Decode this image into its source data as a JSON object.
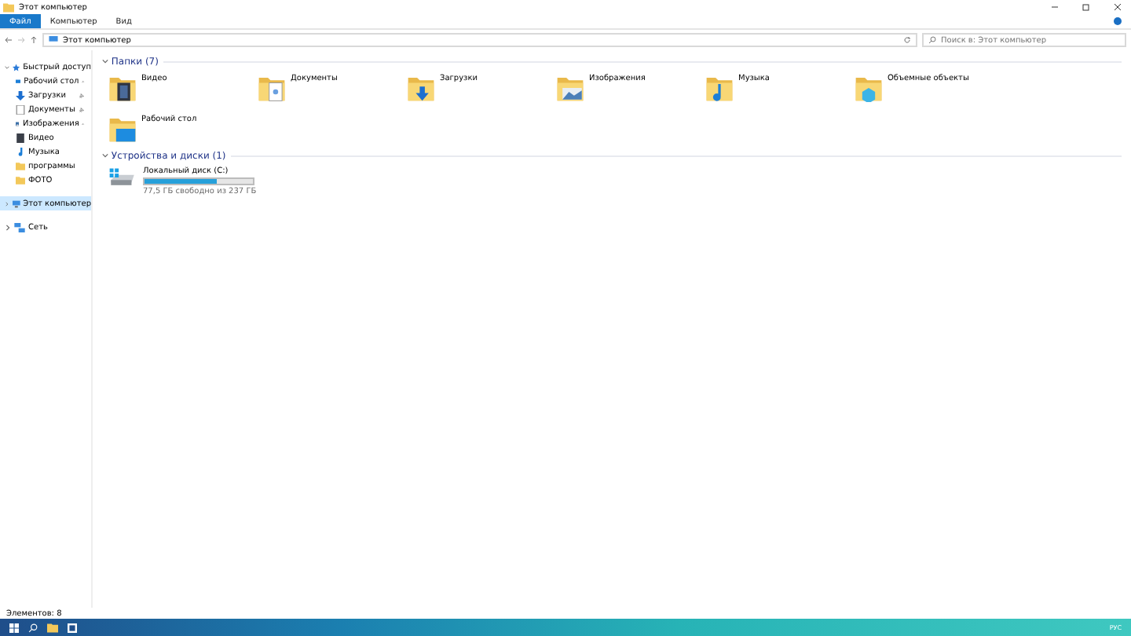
{
  "window": {
    "title": "Этот компьютер"
  },
  "ribbon_tabs": [
    {
      "label": "Файл",
      "selected": true
    },
    {
      "label": "Компьютер",
      "selected": false
    },
    {
      "label": "Вид",
      "selected": false
    }
  ],
  "address_bar": {
    "path": "Этот компьютер"
  },
  "search": {
    "placeholder": "Поиск в: Этот компьютер"
  },
  "sidebar": {
    "items": [
      {
        "label": "Быстрый доступ",
        "kind": "star",
        "expanded": true,
        "selected": false,
        "children": [
          {
            "label": "Рабочий стол",
            "kind": "desktop",
            "pinned": true
          },
          {
            "label": "Загрузки",
            "kind": "download",
            "pinned": true
          },
          {
            "label": "Документы",
            "kind": "document",
            "pinned": true
          },
          {
            "label": "Изображения",
            "kind": "image",
            "pinned": true
          },
          {
            "label": "Видео",
            "kind": "video",
            "pinned": false
          },
          {
            "label": "Музыка",
            "kind": "music",
            "pinned": false
          },
          {
            "label": "программы",
            "kind": "folder",
            "pinned": false
          },
          {
            "label": "ФОТО",
            "kind": "folder",
            "pinned": false
          }
        ]
      },
      {
        "label": "Этот компьютер",
        "kind": "computer",
        "expanded": false,
        "selected": true
      },
      {
        "label": "Сеть",
        "kind": "network",
        "expanded": false,
        "selected": false
      }
    ]
  },
  "folders": {
    "heading": "Папки (7)",
    "items": [
      {
        "label": "Видео",
        "kind": "video"
      },
      {
        "label": "Документы",
        "kind": "document"
      },
      {
        "label": "Загрузки",
        "kind": "download"
      },
      {
        "label": "Изображения",
        "kind": "image"
      },
      {
        "label": "Музыка",
        "kind": "music"
      },
      {
        "label": "Объемные объекты",
        "kind": "objects"
      },
      {
        "label": "Рабочий стол",
        "kind": "desktop"
      }
    ]
  },
  "drives": {
    "heading": "Устройства и диски (1)",
    "items": [
      {
        "label": "Локальный диск (C:)",
        "level": 0.67,
        "free": "77,5 ГБ свободно из 237 ГБ"
      }
    ]
  },
  "status_bar": {
    "text": "Элементов: 8"
  },
  "taskbar": {
    "language": "РУС"
  }
}
